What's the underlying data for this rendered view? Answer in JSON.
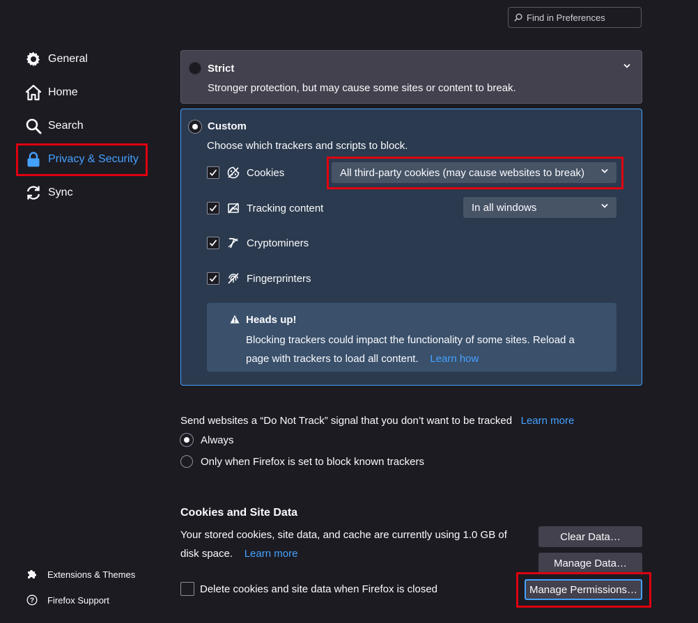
{
  "search": {
    "placeholder": "Find in Preferences"
  },
  "sidebar": {
    "items": [
      {
        "label": "General"
      },
      {
        "label": "Home"
      },
      {
        "label": "Search"
      },
      {
        "label": "Privacy & Security"
      },
      {
        "label": "Sync"
      }
    ],
    "footer": [
      {
        "label": "Extensions & Themes"
      },
      {
        "label": "Firefox Support"
      }
    ]
  },
  "strict": {
    "title": "Strict",
    "description": "Stronger protection, but may cause some sites or content to break."
  },
  "custom": {
    "title": "Custom",
    "description": "Choose which trackers and scripts to block.",
    "rows": [
      {
        "label": "Cookies",
        "dropdown": "All third-party cookies (may cause websites to break)"
      },
      {
        "label": "Tracking content",
        "dropdown": "In all windows"
      },
      {
        "label": "Cryptominers"
      },
      {
        "label": "Fingerprinters"
      }
    ],
    "warning": {
      "title": "Heads up!",
      "body": "Blocking trackers could impact the functionality of some sites. Reload a page with trackers to load all content.",
      "link": "Learn how"
    }
  },
  "dnt": {
    "text": "Send websites a “Do Not Track” signal that you don’t want to be tracked",
    "link": "Learn more",
    "options": [
      {
        "label": "Always"
      },
      {
        "label": "Only when Firefox is set to block known trackers"
      }
    ]
  },
  "cookies_section": {
    "title": "Cookies and Site Data",
    "text": "Your stored cookies, site data, and cache are currently using 1.0 GB of disk space.",
    "link": "Learn more",
    "checkbox_label": "Delete cookies and site data when Firefox is closed",
    "buttons": {
      "clear": "Clear Data…",
      "manage": "Manage Data…",
      "permissions": "Manage Permissions…"
    }
  },
  "colors": {
    "accent": "#45a1ff",
    "highlight": "#e0000f"
  }
}
